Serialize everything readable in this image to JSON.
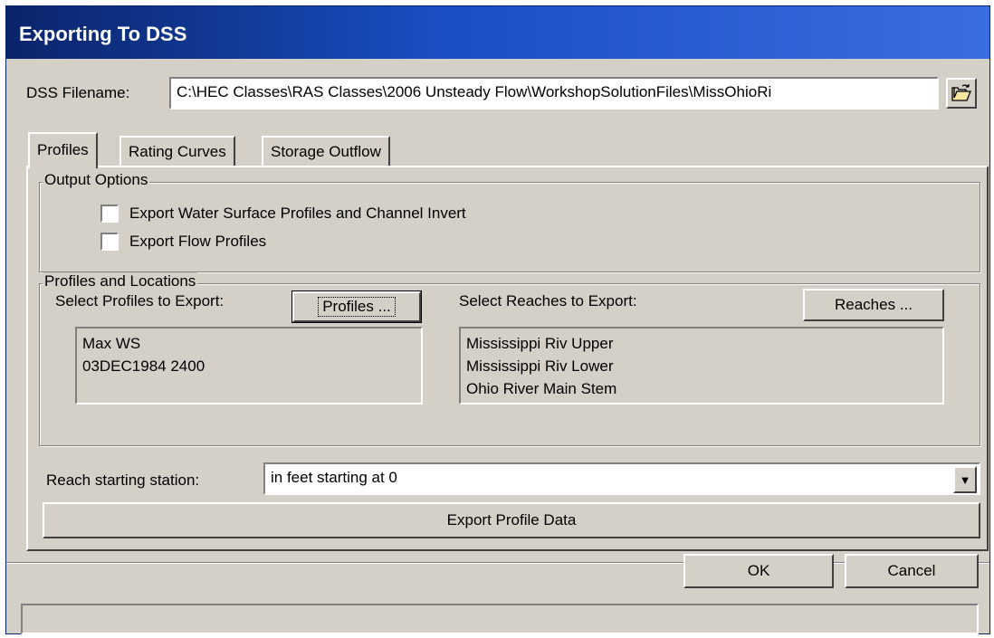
{
  "window": {
    "title": "Exporting To DSS"
  },
  "dss": {
    "label": "DSS Filename:",
    "value": "C:\\HEC Classes\\RAS Classes\\2006 Unsteady Flow\\WorkshopSolutionFiles\\MissOhioRi"
  },
  "tabs": [
    {
      "label": "Profiles",
      "active": true
    },
    {
      "label": "Rating Curves",
      "active": false
    },
    {
      "label": "Storage Outflow",
      "active": false
    }
  ],
  "output_options": {
    "title": "Output Options",
    "checkboxes": [
      {
        "label": "Export Water Surface Profiles and Channel Invert",
        "checked": false
      },
      {
        "label": "Export Flow Profiles",
        "checked": false
      }
    ]
  },
  "profiles_locations": {
    "title": "Profiles and Locations",
    "select_profiles_label": "Select Profiles to Export:",
    "profiles_button": "Profiles ...",
    "profiles_list": [
      "Max WS",
      "03DEC1984 2400"
    ],
    "select_reaches_label": "Select Reaches to Export:",
    "reaches_button": "Reaches ...",
    "reaches_list": [
      "Mississippi Riv Upper",
      "Mississippi Riv Lower",
      "Ohio River Main Stem"
    ]
  },
  "station": {
    "label": "Reach starting station:",
    "value": "in feet starting at 0"
  },
  "export_button": "Export Profile Data",
  "ok_button": "OK",
  "cancel_button": "Cancel",
  "icons": {
    "open_folder": "open-folder-icon",
    "dropdown": "chevron-down-icon"
  }
}
